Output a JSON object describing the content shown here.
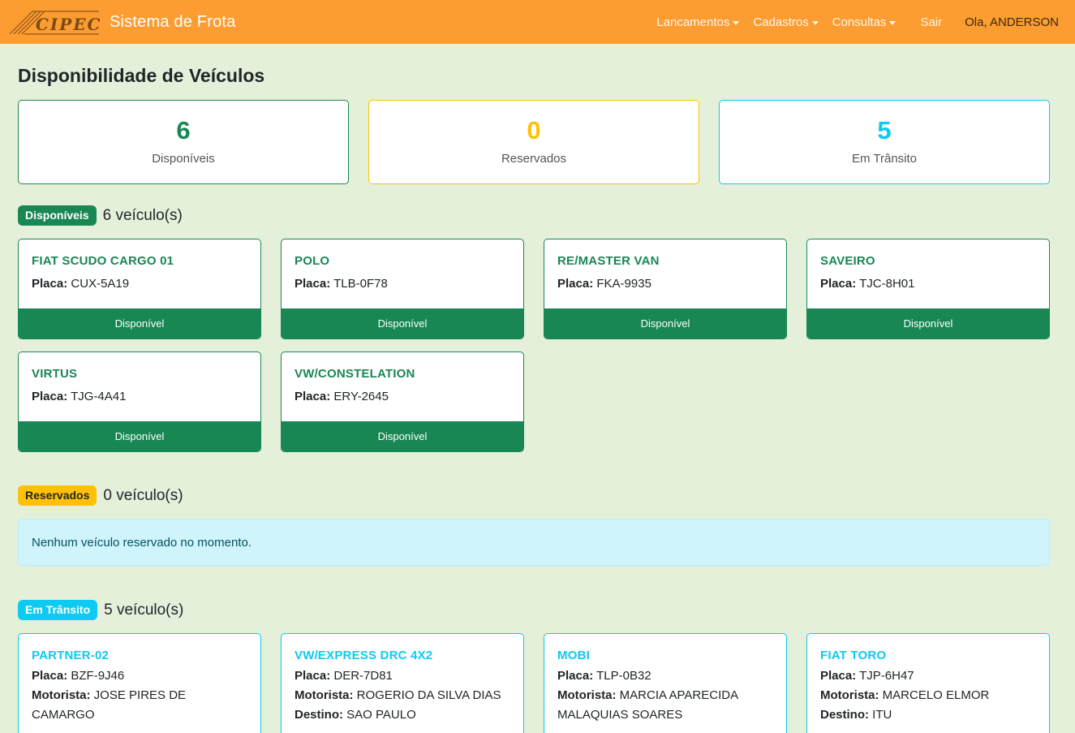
{
  "navbar": {
    "brand_logo_text": "CIPEC",
    "brand_title": "Sistema de Frota",
    "menu": [
      {
        "label": "Lancamentos"
      },
      {
        "label": "Cadastros"
      },
      {
        "label": "Consultas"
      }
    ],
    "logout_label": "Sair",
    "user_greeting": "Ola, ANDERSON",
    "color": "#fd9c31"
  },
  "page": {
    "title": "Disponibilidade de Veículos"
  },
  "stats": [
    {
      "value": "6",
      "label": "Disponíveis",
      "color": "#198754"
    },
    {
      "value": "0",
      "label": "Reservados",
      "color": "#ffc107"
    },
    {
      "value": "5",
      "label": "Em Trânsito",
      "color": "#0dcaf0"
    }
  ],
  "sections": {
    "available": {
      "badge": "Disponíveis",
      "count": "6 veículo(s)",
      "vehicles": [
        {
          "name": "FIAT SCUDO CARGO 01",
          "plate_label": "Placa:",
          "plate": "CUX-5A19",
          "status": "Disponível"
        },
        {
          "name": "POLO",
          "plate_label": "Placa:",
          "plate": "TLB-0F78",
          "status": "Disponível"
        },
        {
          "name": "RE/MASTER VAN",
          "plate_label": "Placa:",
          "plate": "FKA-9935",
          "status": "Disponível"
        },
        {
          "name": "SAVEIRO",
          "plate_label": "Placa:",
          "plate": "TJC-8H01",
          "status": "Disponível"
        },
        {
          "name": "VIRTUS",
          "plate_label": "Placa:",
          "plate": "TJG-4A41",
          "status": "Disponível"
        },
        {
          "name": "VW/CONSTELATION",
          "plate_label": "Placa:",
          "plate": "ERY-2645",
          "status": "Disponível"
        }
      ]
    },
    "reserved": {
      "badge": "Reservados",
      "count": "0 veículo(s)",
      "empty_message": "Nenhum veículo reservado no momento."
    },
    "transit": {
      "badge": "Em Trânsito",
      "count": "5 veículo(s)",
      "vehicles": [
        {
          "name": "PARTNER-02",
          "plate_label": "Placa:",
          "plate": "BZF-9J46",
          "driver_label": "Motorista:",
          "driver": "JOSE PIRES DE CAMARGO",
          "dest_label": "",
          "dest": ""
        },
        {
          "name": "VW/EXPRESS DRC 4X2",
          "plate_label": "Placa:",
          "plate": "DER-7D81",
          "driver_label": "Motorista:",
          "driver": "ROGERIO DA SILVA DIAS",
          "dest_label": "Destino:",
          "dest": "SAO PAULO"
        },
        {
          "name": "MOBI",
          "plate_label": "Placa:",
          "plate": "TLP-0B32",
          "driver_label": "Motorista:",
          "driver": "MARCIA APARECIDA MALAQUIAS SOARES",
          "dest_label": "",
          "dest": ""
        },
        {
          "name": "FIAT TORO",
          "plate_label": "Placa:",
          "plate": "TJP-6H47",
          "driver_label": "Motorista:",
          "driver": "MARCELO ELMOR",
          "dest_label": "Destino:",
          "dest": "ITU"
        }
      ]
    }
  }
}
